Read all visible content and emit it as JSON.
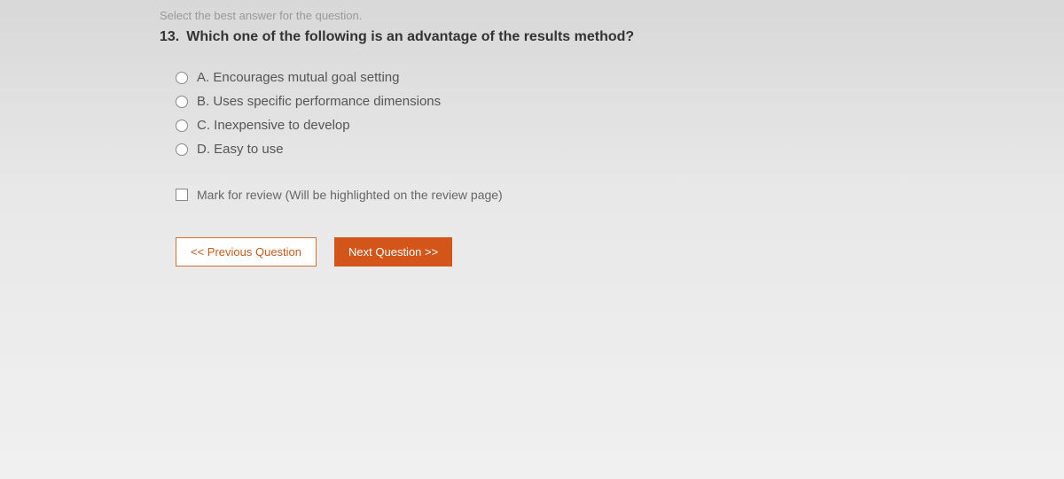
{
  "instruction": "Select the best answer for the question.",
  "question": {
    "number": "13.",
    "text": "Which one of the following is an advantage of the results method?"
  },
  "options": [
    {
      "letter": "A.",
      "text": "Encourages mutual goal setting"
    },
    {
      "letter": "B.",
      "text": "Uses specific performance dimensions"
    },
    {
      "letter": "C.",
      "text": "Inexpensive to develop"
    },
    {
      "letter": "D.",
      "text": "Easy to use"
    }
  ],
  "review": {
    "label": "Mark for review (Will be highlighted on the review page)"
  },
  "nav": {
    "prev": "<< Previous Question",
    "next": "Next Question >>"
  }
}
